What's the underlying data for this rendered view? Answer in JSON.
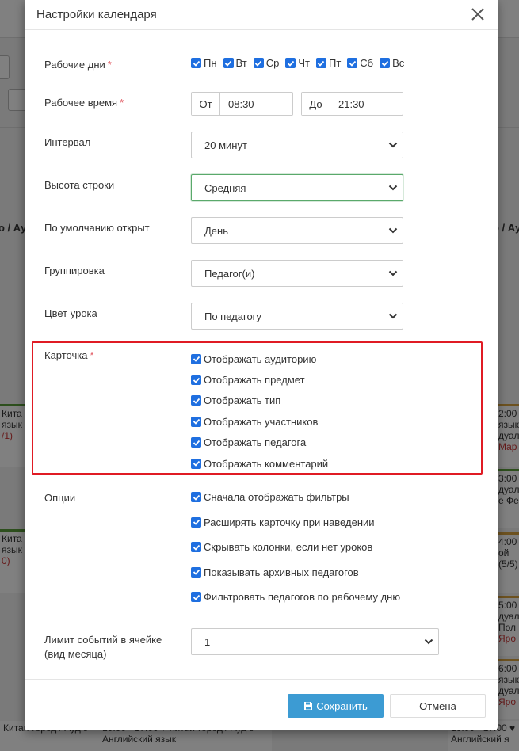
{
  "modal": {
    "title": "Настройки календаря",
    "required_mark": "*",
    "work_days": {
      "label": "Рабочие дни",
      "days": [
        {
          "label": "Пн",
          "checked": true
        },
        {
          "label": "Вт",
          "checked": true
        },
        {
          "label": "Ср",
          "checked": true
        },
        {
          "label": "Чт",
          "checked": true
        },
        {
          "label": "Пт",
          "checked": true
        },
        {
          "label": "Сб",
          "checked": true
        },
        {
          "label": "Вс",
          "checked": true
        }
      ]
    },
    "work_time": {
      "label": "Рабочее время",
      "from_label": "От",
      "from_value": "08:30",
      "to_label": "До",
      "to_value": "21:30"
    },
    "interval": {
      "label": "Интервал",
      "value": "20 минут"
    },
    "row_height": {
      "label": "Высота строки",
      "value": "Средняя"
    },
    "default_open": {
      "label": "По умолчанию открыт",
      "value": "День"
    },
    "grouping": {
      "label": "Группировка",
      "value": "Педагог(и)"
    },
    "lesson_color": {
      "label": "Цвет урока",
      "value": "По педагогу"
    },
    "card": {
      "label": "Карточка",
      "items": [
        {
          "label": "Отображать аудиторию",
          "checked": true
        },
        {
          "label": "Отображать предмет",
          "checked": true
        },
        {
          "label": "Отображать тип",
          "checked": true
        },
        {
          "label": "Отображать участников",
          "checked": true
        },
        {
          "label": "Отображать педагога",
          "checked": true
        },
        {
          "label": "Отображать комментарий",
          "checked": true
        }
      ]
    },
    "options": {
      "label": "Опции",
      "items": [
        {
          "label": "Сначала отображать фильтры",
          "checked": true
        },
        {
          "label": "Расширять карточку при наведении",
          "checked": true
        },
        {
          "label": "Скрывать колонки, если нет уроков",
          "checked": true
        },
        {
          "label": "Показывать архивных педагогов",
          "checked": true
        },
        {
          "label": "Фильтровать педагогов по рабочему дню",
          "checked": true
        }
      ]
    },
    "event_limit": {
      "label_line1": "Лимит событий в ячейке",
      "label_line2": "(вид месяца)",
      "value": "1"
    },
    "save_label": "Сохранить",
    "cancel_label": "Отмена"
  },
  "background": {
    "head_left": "о / Ау",
    "head_right": "о / Ау",
    "events_left": [
      "Кита",
      "язык",
      "/1)",
      "Кита",
      "язык",
      "0)"
    ],
    "events_right": [
      "2:00",
      "язык",
      "дуал",
      "Мар",
      "3:00",
      "дуал",
      "е Фе",
      "4:00",
      "ой",
      "(5/5)",
      "5:00",
      "дуал",
      "Пол",
      "Яро",
      "6:00",
      "язык",
      "дуал",
      "Яро"
    ],
    "bottom_left": "Китаи-город / Ауд з",
    "bottom_mid": "10:00 - 17:00 ♥ Китай-город / Ауд з",
    "bottom_right": "10:00 - 17:00 ♥",
    "bottom_left_sub": "",
    "bottom_mid_sub": "Английский язык",
    "bottom_right_sub": "Английский я"
  },
  "colors": {
    "checkbox": "#1f6fe0",
    "highlight": "#e01b24",
    "save_button": "#3c9bd3",
    "focus_border": "#5aa96b",
    "required": "#e0525b"
  }
}
